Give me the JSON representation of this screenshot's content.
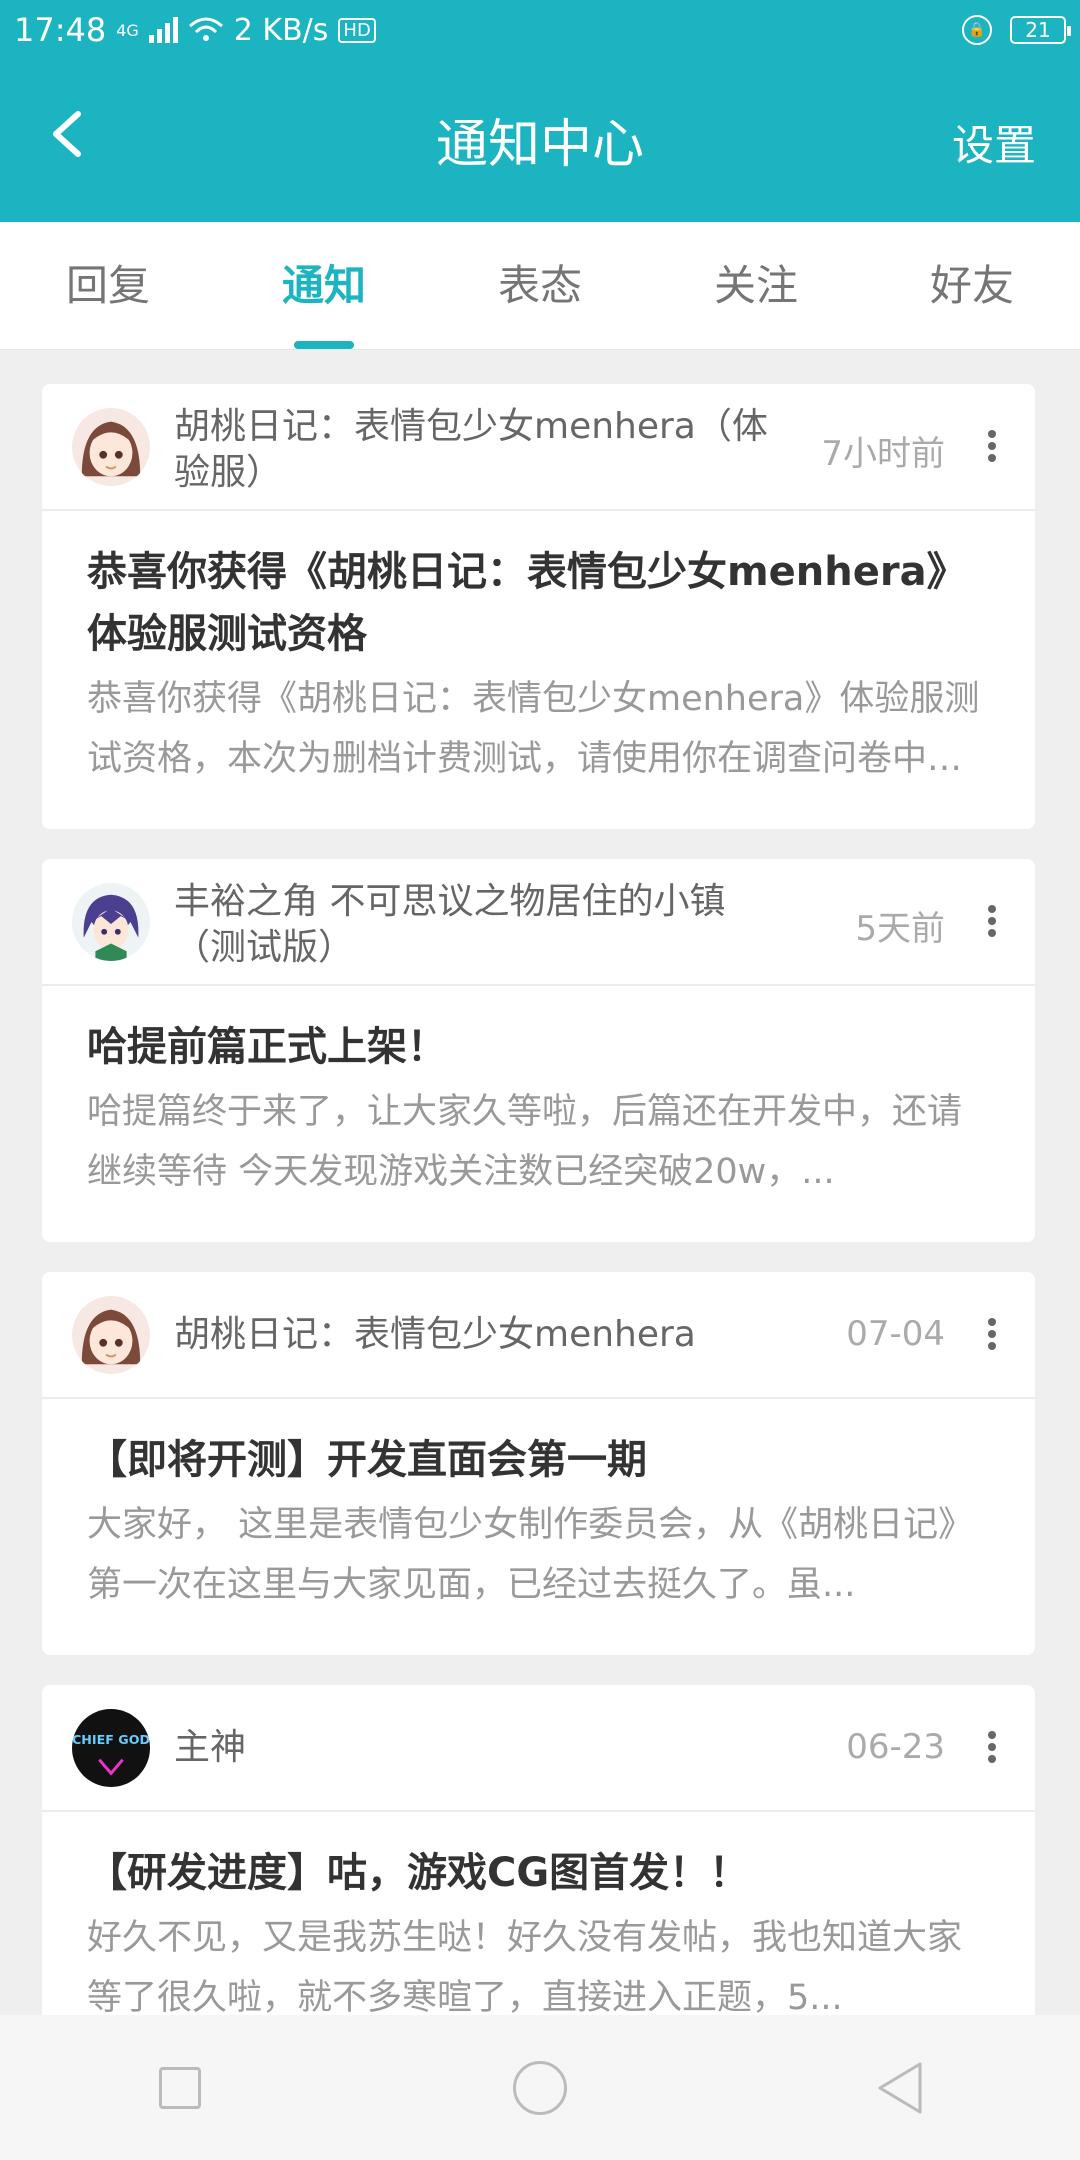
{
  "status_bar": {
    "time": "17:48",
    "network": "4G",
    "speed": "2 KB/s",
    "hd": "HD",
    "battery": "21"
  },
  "header": {
    "title": "通知中心",
    "settings_label": "设置"
  },
  "tabs": [
    {
      "label": "回复",
      "active": false
    },
    {
      "label": "通知",
      "active": true
    },
    {
      "label": "表态",
      "active": false
    },
    {
      "label": "关注",
      "active": false
    },
    {
      "label": "好友",
      "active": false
    }
  ],
  "cards": [
    {
      "source": "胡桃日记：表情包少女menhera（体验服）",
      "time": "7小时前",
      "title": "恭喜你获得《胡桃日记：表情包少女menhera》体验服测试资格",
      "excerpt": "恭喜你获得《胡桃日记：表情包少女menhera》体验服测试资格，本次为删档计费测试，请使用你在调查问卷中填写的账号登录..."
    },
    {
      "source": "丰裕之角 不可思议之物居住的小镇（测试版）",
      "time": "5天前",
      "title": "哈提前篇正式上架！",
      "excerpt": "哈提篇终于来了，让大家久等啦，后篇还在开发中，还请继续等待 今天发现游戏关注数已经突破20w，..."
    },
    {
      "source": "胡桃日记：表情包少女menhera",
      "time": "07-04",
      "title": "【即将开测】开发直面会第一期",
      "excerpt": "大家好， 这里是表情包少女制作委员会，从《胡桃日记》第一次在这里与大家见面，已经过去挺久了。虽..."
    },
    {
      "source": "主神",
      "time": "06-23",
      "title": "【研发进度】咕，游戏CG图首发！！",
      "excerpt": "好久不见，又是我苏生哒！好久没有发帖，我也知道大家等了很久啦，就不多寒暄了，直接进入正题，5..."
    }
  ],
  "avatar_text": {
    "chief_god": "CHIEF GOD"
  },
  "colors": {
    "brand": "#1db4c2"
  }
}
